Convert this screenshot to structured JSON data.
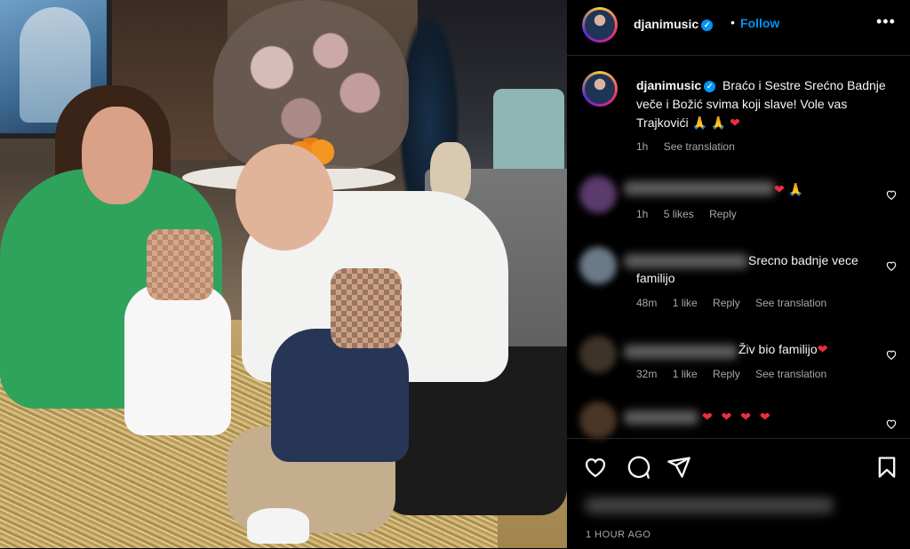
{
  "header": {
    "username": "djanimusic",
    "dot": "•",
    "follow_label": "Follow",
    "more_label": "•••"
  },
  "caption": {
    "username": "djanimusic",
    "text": "Braćo i Sestre Srećno Badnje veče i Božić svima koji slave! Vole vas Trajkovići 🙏 🙏",
    "heart": "❤",
    "time": "1h",
    "see_translation": "See translation"
  },
  "comments": [
    {
      "text": "❤ 🙏",
      "time": "1h",
      "likes": "5 likes",
      "reply": "Reply",
      "see_translation": ""
    },
    {
      "text": "Srecno badnje vece familijo",
      "time": "48m",
      "likes": "1 like",
      "reply": "Reply",
      "see_translation": "See translation"
    },
    {
      "text": "Živ bio familijo",
      "heart": "❤",
      "time": "32m",
      "likes": "1 like",
      "reply": "Reply",
      "see_translation": "See translation"
    },
    {
      "text": "❤ ❤ ❤ ❤"
    }
  ],
  "footer": {
    "time_ago": "1 HOUR AGO"
  },
  "icons": {
    "like": "heart-icon",
    "comment": "comment-icon",
    "share": "share-icon",
    "save": "bookmark-icon",
    "verified": "verified-badge-icon",
    "more": "more-options-icon"
  },
  "colors": {
    "background": "#000000",
    "accent": "#0095f6",
    "heart": "#ed2d42",
    "muted": "#a8a8a8"
  }
}
